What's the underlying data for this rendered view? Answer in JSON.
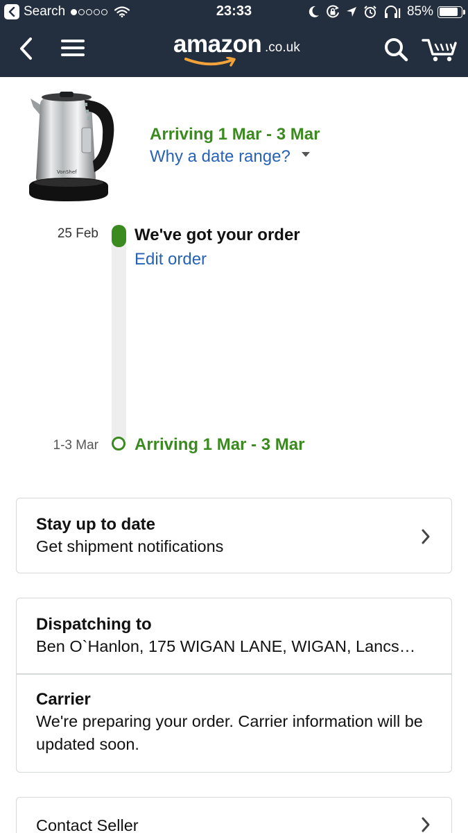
{
  "status_bar": {
    "back_app": "Search",
    "time": "23:33",
    "battery": "85%",
    "battery_level": 0.85,
    "icons": [
      "moon-icon",
      "rotation-lock-icon",
      "location-icon",
      "alarm-icon",
      "headphones-icon"
    ]
  },
  "nav": {
    "logo_text": "amazon",
    "logo_tld": ".co.uk",
    "icons": [
      "back-icon",
      "menu-icon",
      "search-icon",
      "cart-icon"
    ]
  },
  "shipment": {
    "arriving": "Arriving 1 Mar - 3 Mar",
    "why_link": "Why a date range?",
    "product_brand": "VonShef"
  },
  "timeline": {
    "steps": [
      {
        "date": "25 Feb",
        "title": "We've got your order",
        "link": "Edit order"
      },
      {
        "date": "1-3 Mar",
        "title": "Arriving 1 Mar - 3 Mar"
      }
    ]
  },
  "notifications_card": {
    "title": "Stay up to date",
    "subtitle": "Get shipment notifications"
  },
  "dispatch_card": {
    "dispatch_title": "Dispatching to",
    "dispatch_address": "Ben O`Hanlon, 175 WIGAN LANE, WIGAN, Lancs…",
    "carrier_title": "Carrier",
    "carrier_text": "We're preparing your order. Carrier information will be updated soon."
  },
  "contact_card": {
    "title": "Contact Seller"
  },
  "colors": {
    "header_bg": "#232f3e",
    "accent_green": "#3a8a20",
    "link_blue": "#2762b5",
    "logo_smile": "#f2a23a"
  }
}
